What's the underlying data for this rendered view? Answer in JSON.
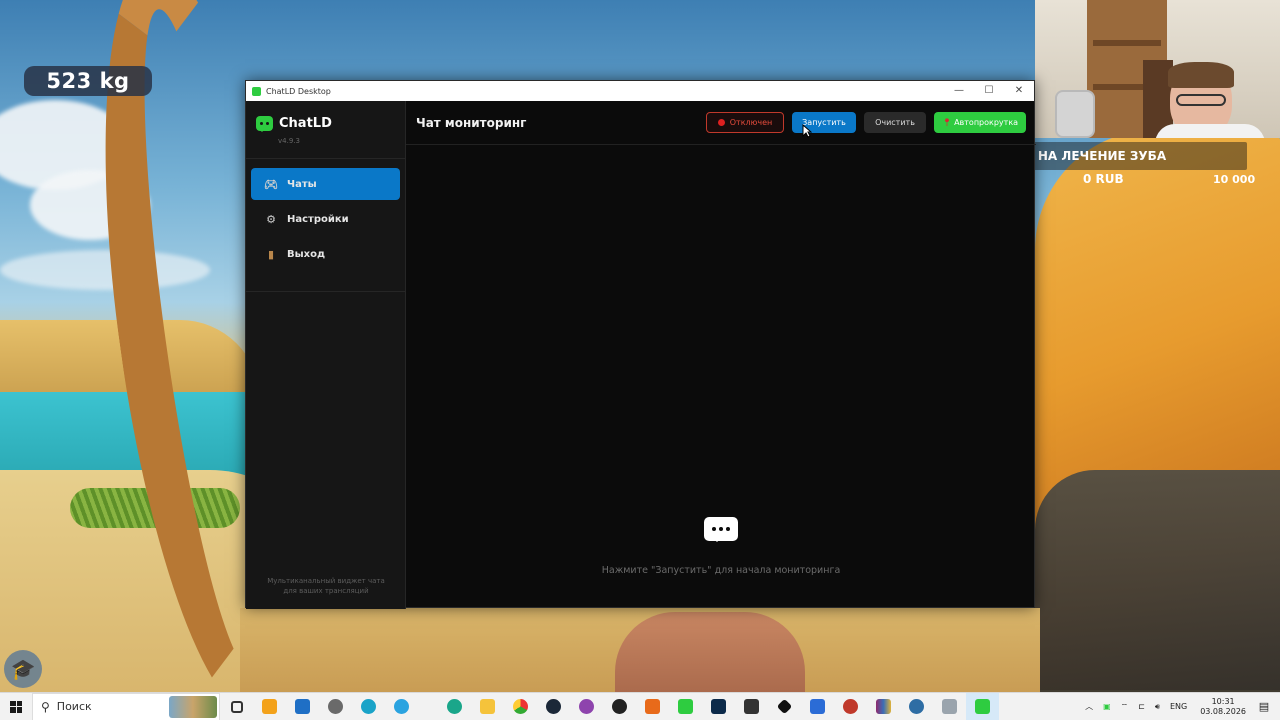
{
  "overlay": {
    "weight": "523 kg",
    "goal_title": "НА ЛЕЧЕНИЕ ЗУБА",
    "goal_left": "0",
    "goal_current": "0 RUB",
    "goal_target": "10 000"
  },
  "window": {
    "title": "ChatLD Desktop",
    "controls": {
      "minimize": "—",
      "maximize": "☐",
      "close": "✕"
    }
  },
  "sidebar": {
    "app_name": "ChatLD",
    "version": "v4.9.3",
    "items": [
      {
        "label": "Чаты",
        "icon": "gamepad-icon",
        "active": true
      },
      {
        "label": "Настройки",
        "icon": "gear-icon",
        "active": false
      },
      {
        "label": "Выход",
        "icon": "door-icon",
        "active": false
      }
    ],
    "footer": "Мультиканальный виджет чата для ваших трансляций"
  },
  "header": {
    "title": "Чат мониторинг",
    "status_label": "Отключен",
    "start_label": "Запустить",
    "clear_label": "Очистить",
    "autoscroll_label": "Автопрокрутка"
  },
  "empty_state": {
    "message": "Нажмите \"Запустить\" для начала мониторинга"
  },
  "taskbar": {
    "search_placeholder": "Поиск",
    "language": "ENG",
    "time": "10:31",
    "date": "03.08.2026"
  },
  "colors": {
    "accent_blue": "#0a78c8",
    "accent_green": "#2ecc40",
    "status_red": "#e02020"
  }
}
